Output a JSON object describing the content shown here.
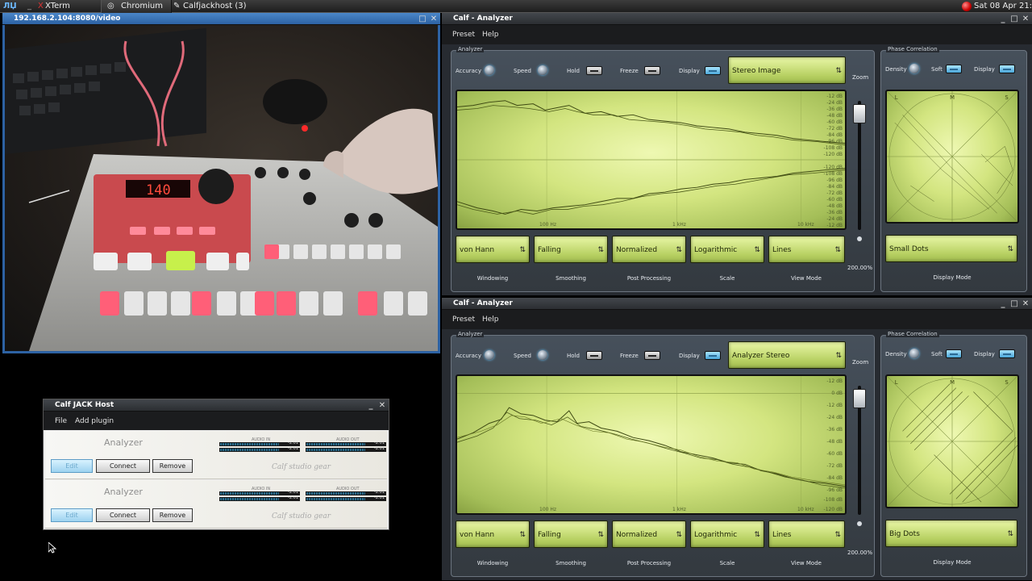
{
  "taskbar": {
    "tabs": [
      {
        "label": "XTerm",
        "icon": "x-icon"
      },
      {
        "label": "Chromium",
        "icon": "chromium-icon"
      },
      {
        "label": "Calfjackhost (3)",
        "icon": "calf-icon"
      }
    ],
    "clock": "Sat 08 Apr 21:03"
  },
  "video_window": {
    "title": "192.168.2.104:8080/video",
    "device_display": "140"
  },
  "analyzers": [
    {
      "title": "Calf - Analyzer",
      "menu": [
        "Preset",
        "Help"
      ],
      "main_panel_label": "Analyzer",
      "phase_panel_label": "Phase Correlation",
      "controls": {
        "accuracy": "Accuracy",
        "speed": "Speed",
        "hold": "Hold",
        "freeze": "Freeze",
        "display": "Display",
        "zoom": "Zoom",
        "density": "Density",
        "soft": "Soft",
        "phase_display": "Display"
      },
      "display_mode": "Stereo Image",
      "db_ticks": [
        "-12 dB",
        "-24 dB",
        "-36 dB",
        "-48 dB",
        "-60 dB",
        "-72 dB",
        "-84 dB",
        "-96 dB",
        "-108 dB",
        "-120 dB",
        "-120 dB",
        "-108 dB",
        "-96 dB",
        "-84 dB",
        "-72 dB",
        "-60 dB",
        "-48 dB",
        "-36 dB",
        "-24 dB",
        "-12 dB"
      ],
      "hz_ticks": [
        "100 Hz",
        "1 kHz",
        "10 kHz"
      ],
      "zoom_value": "200.00%",
      "selects": [
        {
          "value": "von Hann",
          "label": "Windowing"
        },
        {
          "value": "Falling",
          "label": "Smoothing"
        },
        {
          "value": "Normalized",
          "label": "Post Processing"
        },
        {
          "value": "Logarithmic",
          "label": "Scale"
        },
        {
          "value": "Lines",
          "label": "View Mode"
        }
      ],
      "phase_mode": {
        "value": "Small Dots",
        "label": "Display Mode"
      },
      "phase_marks": {
        "left": "L",
        "mid": "M",
        "right": "S"
      }
    },
    {
      "title": "Calf - Analyzer",
      "menu": [
        "Preset",
        "Help"
      ],
      "main_panel_label": "Analyzer",
      "phase_panel_label": "Phase Correlation",
      "controls": {
        "accuracy": "Accuracy",
        "speed": "Speed",
        "hold": "Hold",
        "freeze": "Freeze",
        "display": "Display",
        "zoom": "Zoom",
        "density": "Density",
        "soft": "Soft",
        "phase_display": "Display"
      },
      "display_mode": "Analyzer Stereo",
      "db_ticks": [
        "-12 dB",
        "0 dB",
        "-12 dB",
        "-24 dB",
        "-36 dB",
        "-48 dB",
        "-60 dB",
        "-72 dB",
        "-84 dB",
        "-96 dB",
        "-108 dB",
        "-120 dB"
      ],
      "hz_ticks": [
        "100 Hz",
        "1 kHz",
        "10 kHz"
      ],
      "zoom_value": "200.00%",
      "selects": [
        {
          "value": "von Hann",
          "label": "Windowing"
        },
        {
          "value": "Falling",
          "label": "Smoothing"
        },
        {
          "value": "Normalized",
          "label": "Post Processing"
        },
        {
          "value": "Logarithmic",
          "label": "Scale"
        },
        {
          "value": "Lines",
          "label": "View Mode"
        }
      ],
      "phase_mode": {
        "value": "Big Dots",
        "label": "Display Mode"
      },
      "phase_marks": {
        "left": "L",
        "mid": "M",
        "right": "S"
      }
    }
  ],
  "jack_host": {
    "title": "Calf JACK Host",
    "menu": [
      "File",
      "Add plugin"
    ],
    "plugins": [
      {
        "name": "Analyzer",
        "edit": "Edit",
        "connect": "Connect",
        "remove": "Remove",
        "audio_in": "AUDIO IN",
        "audio_out": "AUDIO OUT",
        "levels": [
          "-2.01",
          "-2.01",
          "-2.01",
          "-2.01"
        ]
      },
      {
        "name": "Analyzer",
        "edit": "Edit",
        "connect": "Connect",
        "remove": "Remove",
        "audio_in": "AUDIO IN",
        "audio_out": "AUDIO OUT",
        "levels": [
          "-2.01",
          "-2.01",
          "-2.01",
          "-2.01"
        ]
      }
    ],
    "logo": "Calf studio gear"
  }
}
